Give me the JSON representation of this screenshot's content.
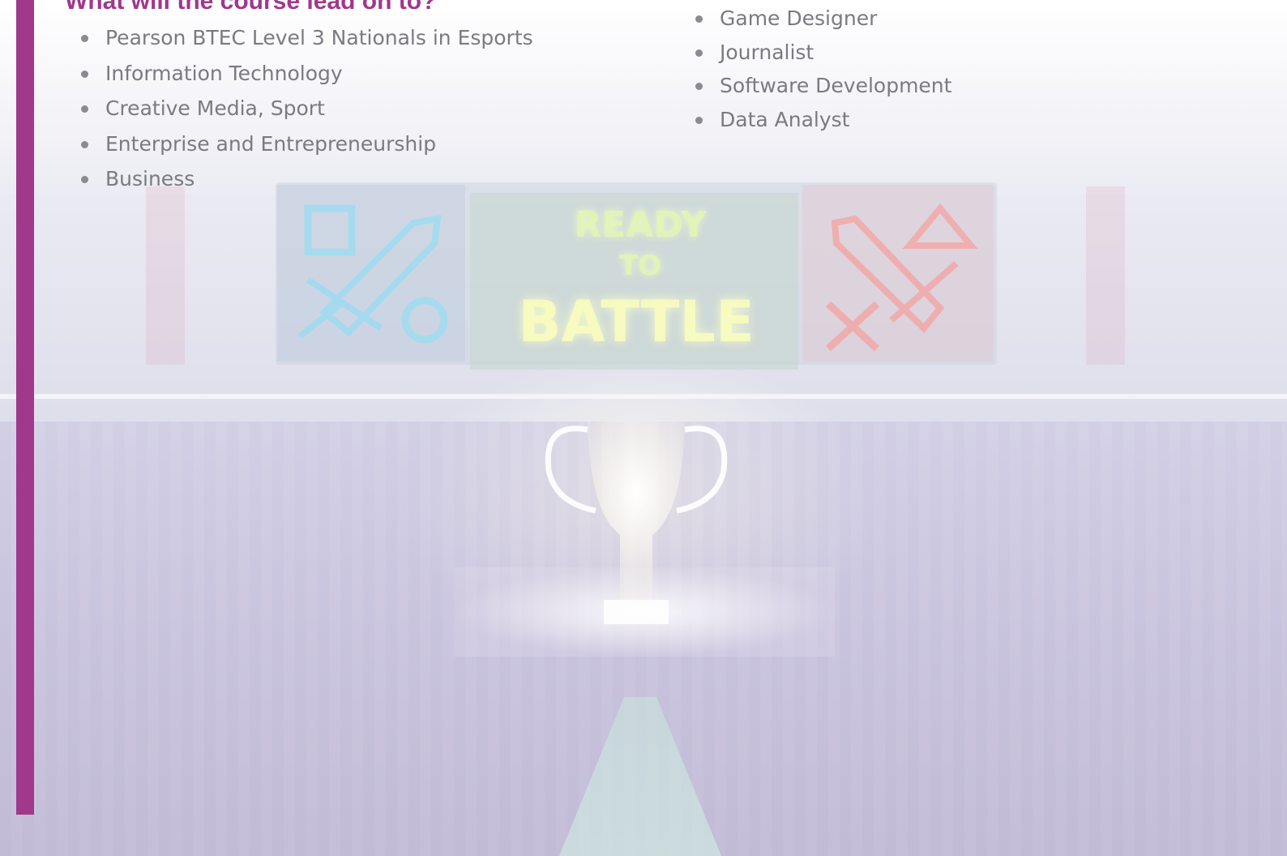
{
  "heading": "What will the course lead on to?",
  "progression": [
    "Pearson BTEC Level 3 Nationals in Esports",
    "Information Technology",
    "Creative Media, Sport",
    "Enterprise and Entrepreneurship",
    "Business"
  ],
  "careers": [
    "Game Designer",
    "Journalist",
    "Software Development",
    "Data Analyst"
  ],
  "background_sign": {
    "line1": "READY",
    "line2": "TO",
    "line3": "BATTLE"
  },
  "colors": {
    "accent": "#a0388c",
    "body_text": "#7a7a80",
    "neon_blue": "#9fdcf0",
    "neon_red": "#f2a8a8",
    "neon_yellow": "#f4fab0"
  },
  "icons": [
    "square-icon",
    "sword-icon",
    "circle-icon",
    "triangle-icon",
    "cross-icon",
    "trophy-icon"
  ]
}
